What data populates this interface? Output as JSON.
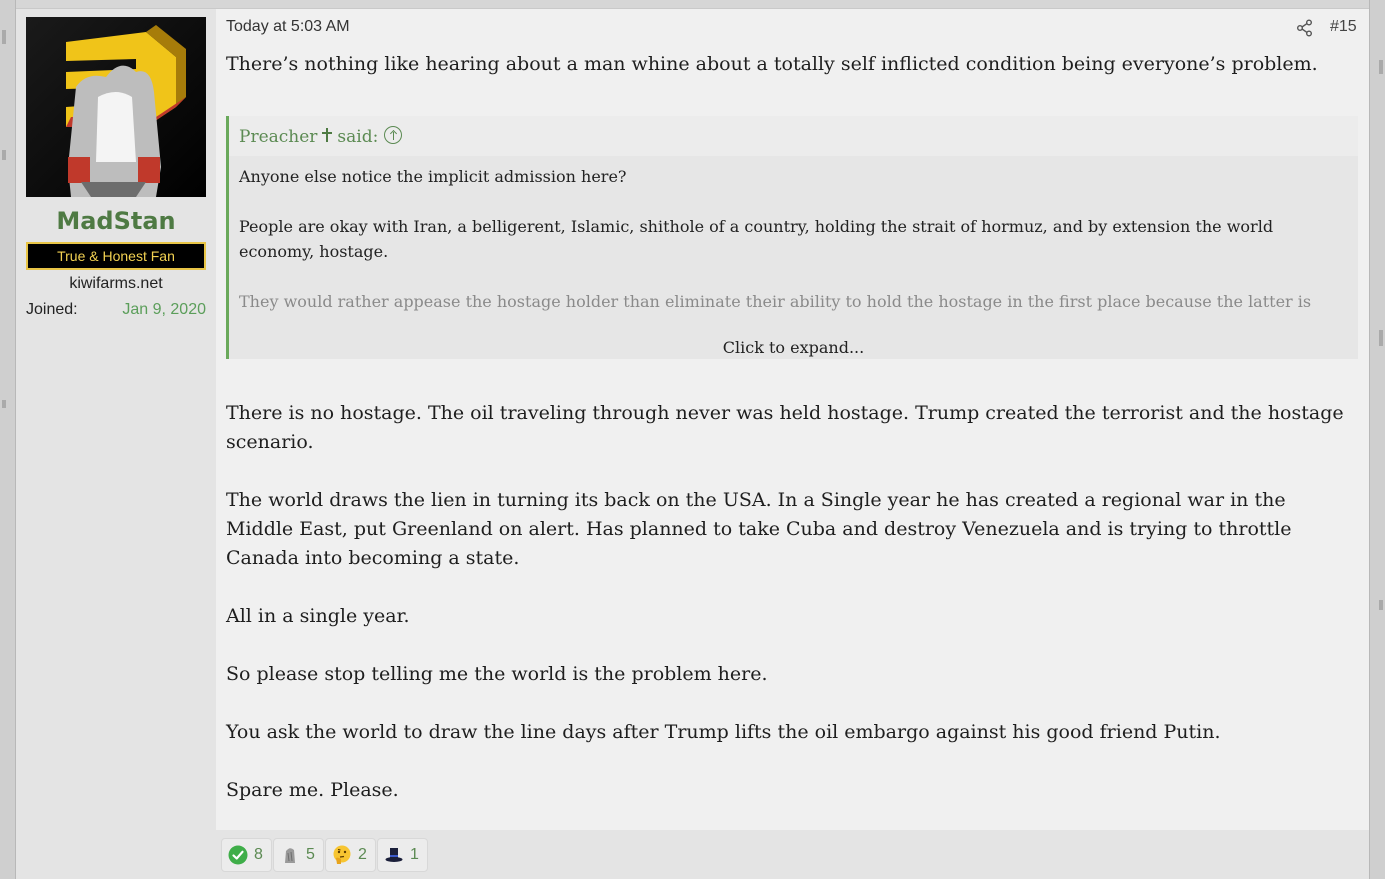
{
  "user": {
    "username": "MadStan",
    "title": "True & Honest Fan",
    "site": "kiwifarms.net",
    "joined_label": "Joined:",
    "joined_date": "Jan 9, 2020"
  },
  "post": {
    "date": "Today at 5:03 AM",
    "number": "#15",
    "first_line": "There’s nothing like hearing about a man whine about a totally self inflicted condition being everyone’s problem."
  },
  "quote": {
    "author": "Preacher",
    "said": "said:",
    "paragraphs": [
      "Anyone else notice the implicit admission here?",
      "People are okay with Iran, a belligerent, Islamic, shithole of a country, holding the strait of hormuz, and by extension the world economy, hostage.",
      "They would rather appease the hostage holder than eliminate their ability to hold the hostage in the first place because the latter is mildly inconvenient."
    ],
    "expand": "Click to expand..."
  },
  "reply": {
    "paragraphs": [
      "There is no hostage. The oil traveling through never was held hostage. Trump created the terrorist and the hostage scenario.",
      "The world draws the lien in turning its back on the USA. In a Single year he has created a regional war in the Middle East, put Greenland on alert. Has planned to take Cuba and destroy Venezuela and is trying to throttle Canada into becoming a state.",
      "All in a single year.",
      "So please stop telling me the world is the problem here.",
      "You ask the world to draw the line days after Trump lifts the oil embargo against his good friend Putin.",
      "Spare me. Please."
    ]
  },
  "reactions": [
    {
      "icon": "check-icon",
      "count": "8"
    },
    {
      "icon": "stone-icon",
      "count": "5"
    },
    {
      "icon": "thinking-face-icon",
      "count": "2"
    },
    {
      "icon": "top-hat-icon",
      "count": "1"
    }
  ],
  "colors": {
    "username": "#4e7a43",
    "title_text": "#f2d152",
    "joined_date": "#5b9e5a",
    "quote_border": "#6aa95b",
    "reaction_count": "#5b8a52"
  }
}
